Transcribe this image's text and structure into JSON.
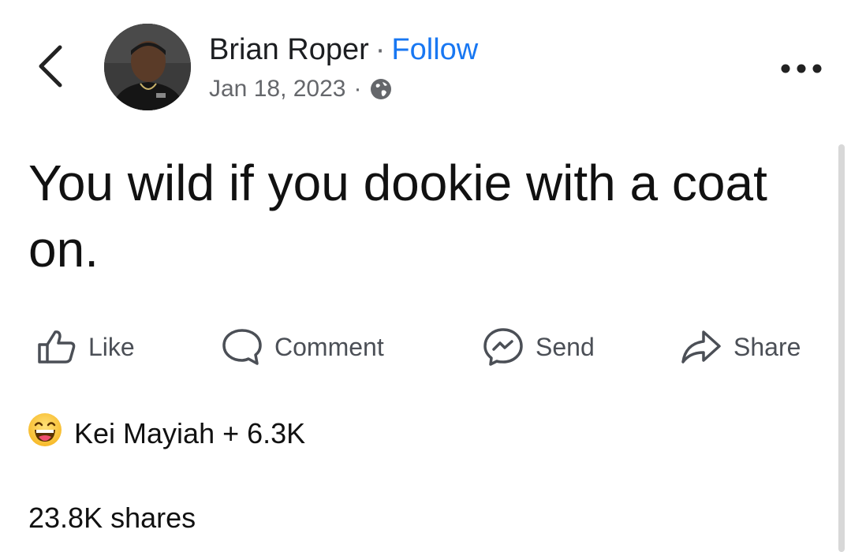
{
  "post": {
    "author": "Brian Roper",
    "separator": "·",
    "follow": "Follow",
    "date": "Jan 18, 2023",
    "date_separator": "·",
    "privacy_icon": "globe-icon",
    "text": "You wild if you dookie with a coat on."
  },
  "actions": {
    "like": "Like",
    "comment": "Comment",
    "send": "Send",
    "share": "Share"
  },
  "reactions": {
    "icon": "laughing-emoji-icon",
    "summary": "Kei Mayiah + 6.3K"
  },
  "shares": "23.8K shares",
  "colors": {
    "follow": "#1877f2",
    "meta_gray": "#65676b",
    "text": "#111111"
  }
}
